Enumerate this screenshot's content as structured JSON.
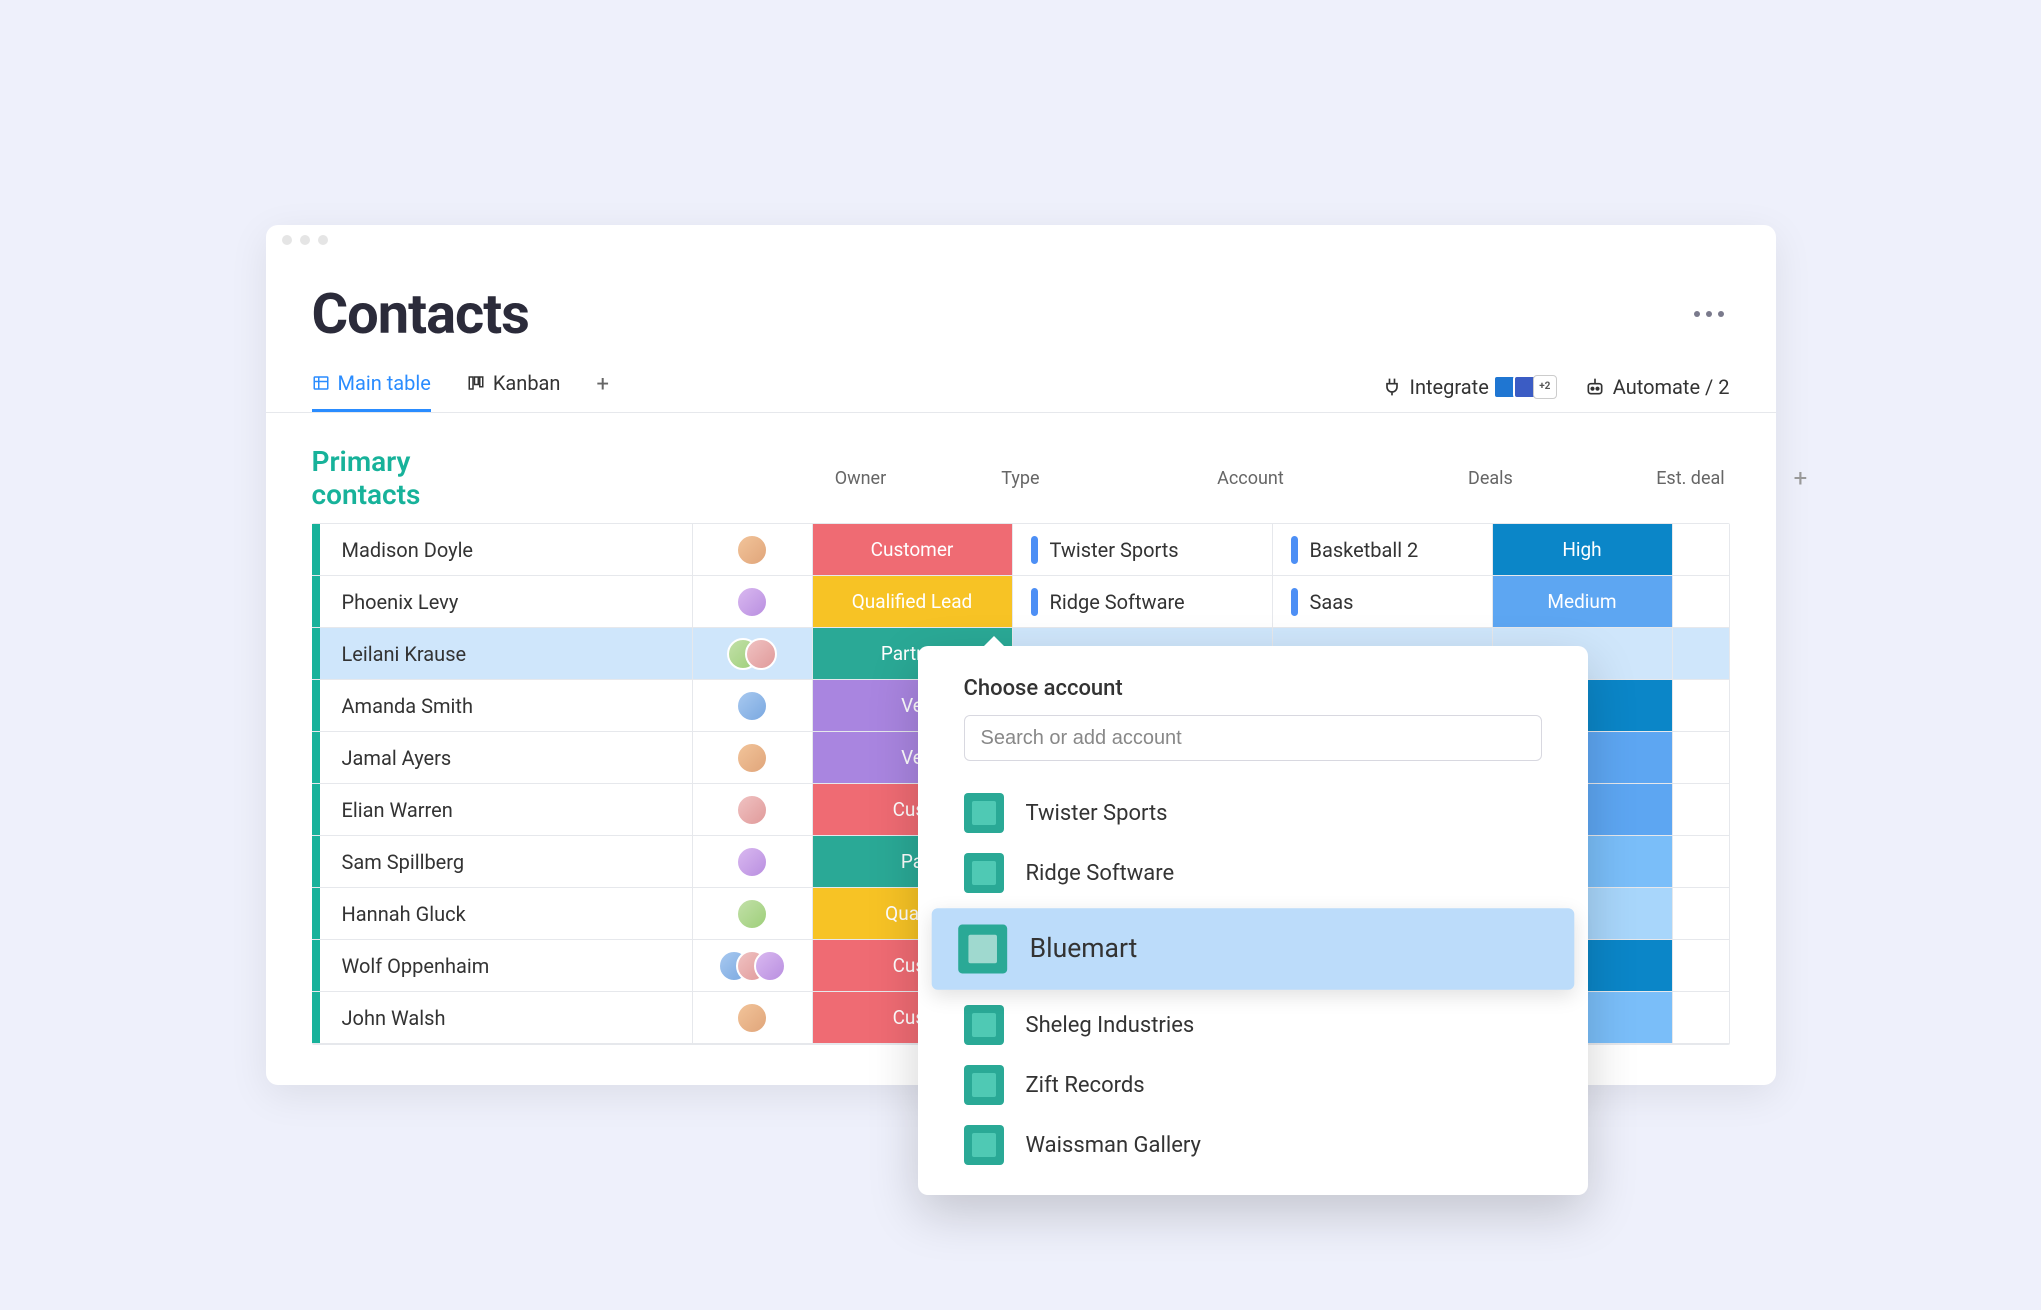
{
  "header": {
    "title": "Contacts"
  },
  "tabs": {
    "main": "Main table",
    "kanban": "Kanban",
    "integrate": "Integrate",
    "integrate_extra": "+2",
    "automate": "Automate / 2"
  },
  "group": {
    "name": "Primary contacts",
    "columns": {
      "owner": "Owner",
      "type": "Type",
      "account": "Account",
      "deals": "Deals",
      "est": "Est. deal"
    }
  },
  "rows": [
    {
      "name": "Madison Doyle",
      "type": "Customer",
      "type_cls": "bg-customer",
      "account": "Twister Sports",
      "deal": "Basketball 2",
      "est": "High",
      "est_cls": "bg-high",
      "av": "av-a"
    },
    {
      "name": "Phoenix Levy",
      "type": "Qualified Lead",
      "type_cls": "bg-qlead",
      "account": "Ridge Software",
      "deal": "Saas",
      "est": "Medium",
      "est_cls": "bg-medium",
      "av": "av-b"
    },
    {
      "name": "Leilani Krause",
      "type": "Partner",
      "type_cls": "bg-partner",
      "account": "",
      "deal": "",
      "est": "",
      "est_cls": "",
      "av": "av-c",
      "selected": true,
      "multi": true
    },
    {
      "name": "Amanda Smith",
      "type": "Ve",
      "type_cls": "bg-vendor",
      "account": "",
      "deal": "",
      "est": "",
      "est_cls": "bg-blue1",
      "av": "av-d"
    },
    {
      "name": "Jamal Ayers",
      "type": "Ve",
      "type_cls": "bg-vendor",
      "account": "",
      "deal": "",
      "est": "",
      "est_cls": "bg-blue2",
      "av": "av-a"
    },
    {
      "name": "Elian Warren",
      "type": "Cust",
      "type_cls": "bg-customer",
      "account": "",
      "deal": "",
      "est": "",
      "est_cls": "bg-blue2",
      "av": "av-e"
    },
    {
      "name": "Sam Spillberg",
      "type": "Pa",
      "type_cls": "bg-partner",
      "account": "",
      "deal": "",
      "est": "",
      "est_cls": "bg-blue3",
      "av": "av-b"
    },
    {
      "name": "Hannah Gluck",
      "type": "Qualifi",
      "type_cls": "bg-qlead",
      "account": "",
      "deal": "",
      "est": "",
      "est_cls": "bg-blue4",
      "av": "av-c"
    },
    {
      "name": "Wolf Oppenhaim",
      "type": "Cust",
      "type_cls": "bg-customer",
      "account": "",
      "deal": "",
      "est": "",
      "est_cls": "bg-blue1",
      "av": "av-d",
      "multi": true
    },
    {
      "name": "John Walsh",
      "type": "Cust",
      "type_cls": "bg-customer",
      "account": "",
      "deal": "",
      "est": "",
      "est_cls": "bg-blue3",
      "av": "av-a"
    }
  ],
  "popup": {
    "title": "Choose account",
    "placeholder": "Search or add account",
    "options": [
      {
        "label": "Twister Sports"
      },
      {
        "label": "Ridge Software"
      },
      {
        "label": "Bluemart",
        "hover": true
      },
      {
        "label": "Sheleg Industries"
      },
      {
        "label": "Zift Records"
      },
      {
        "label": "Waissman Gallery"
      }
    ]
  }
}
